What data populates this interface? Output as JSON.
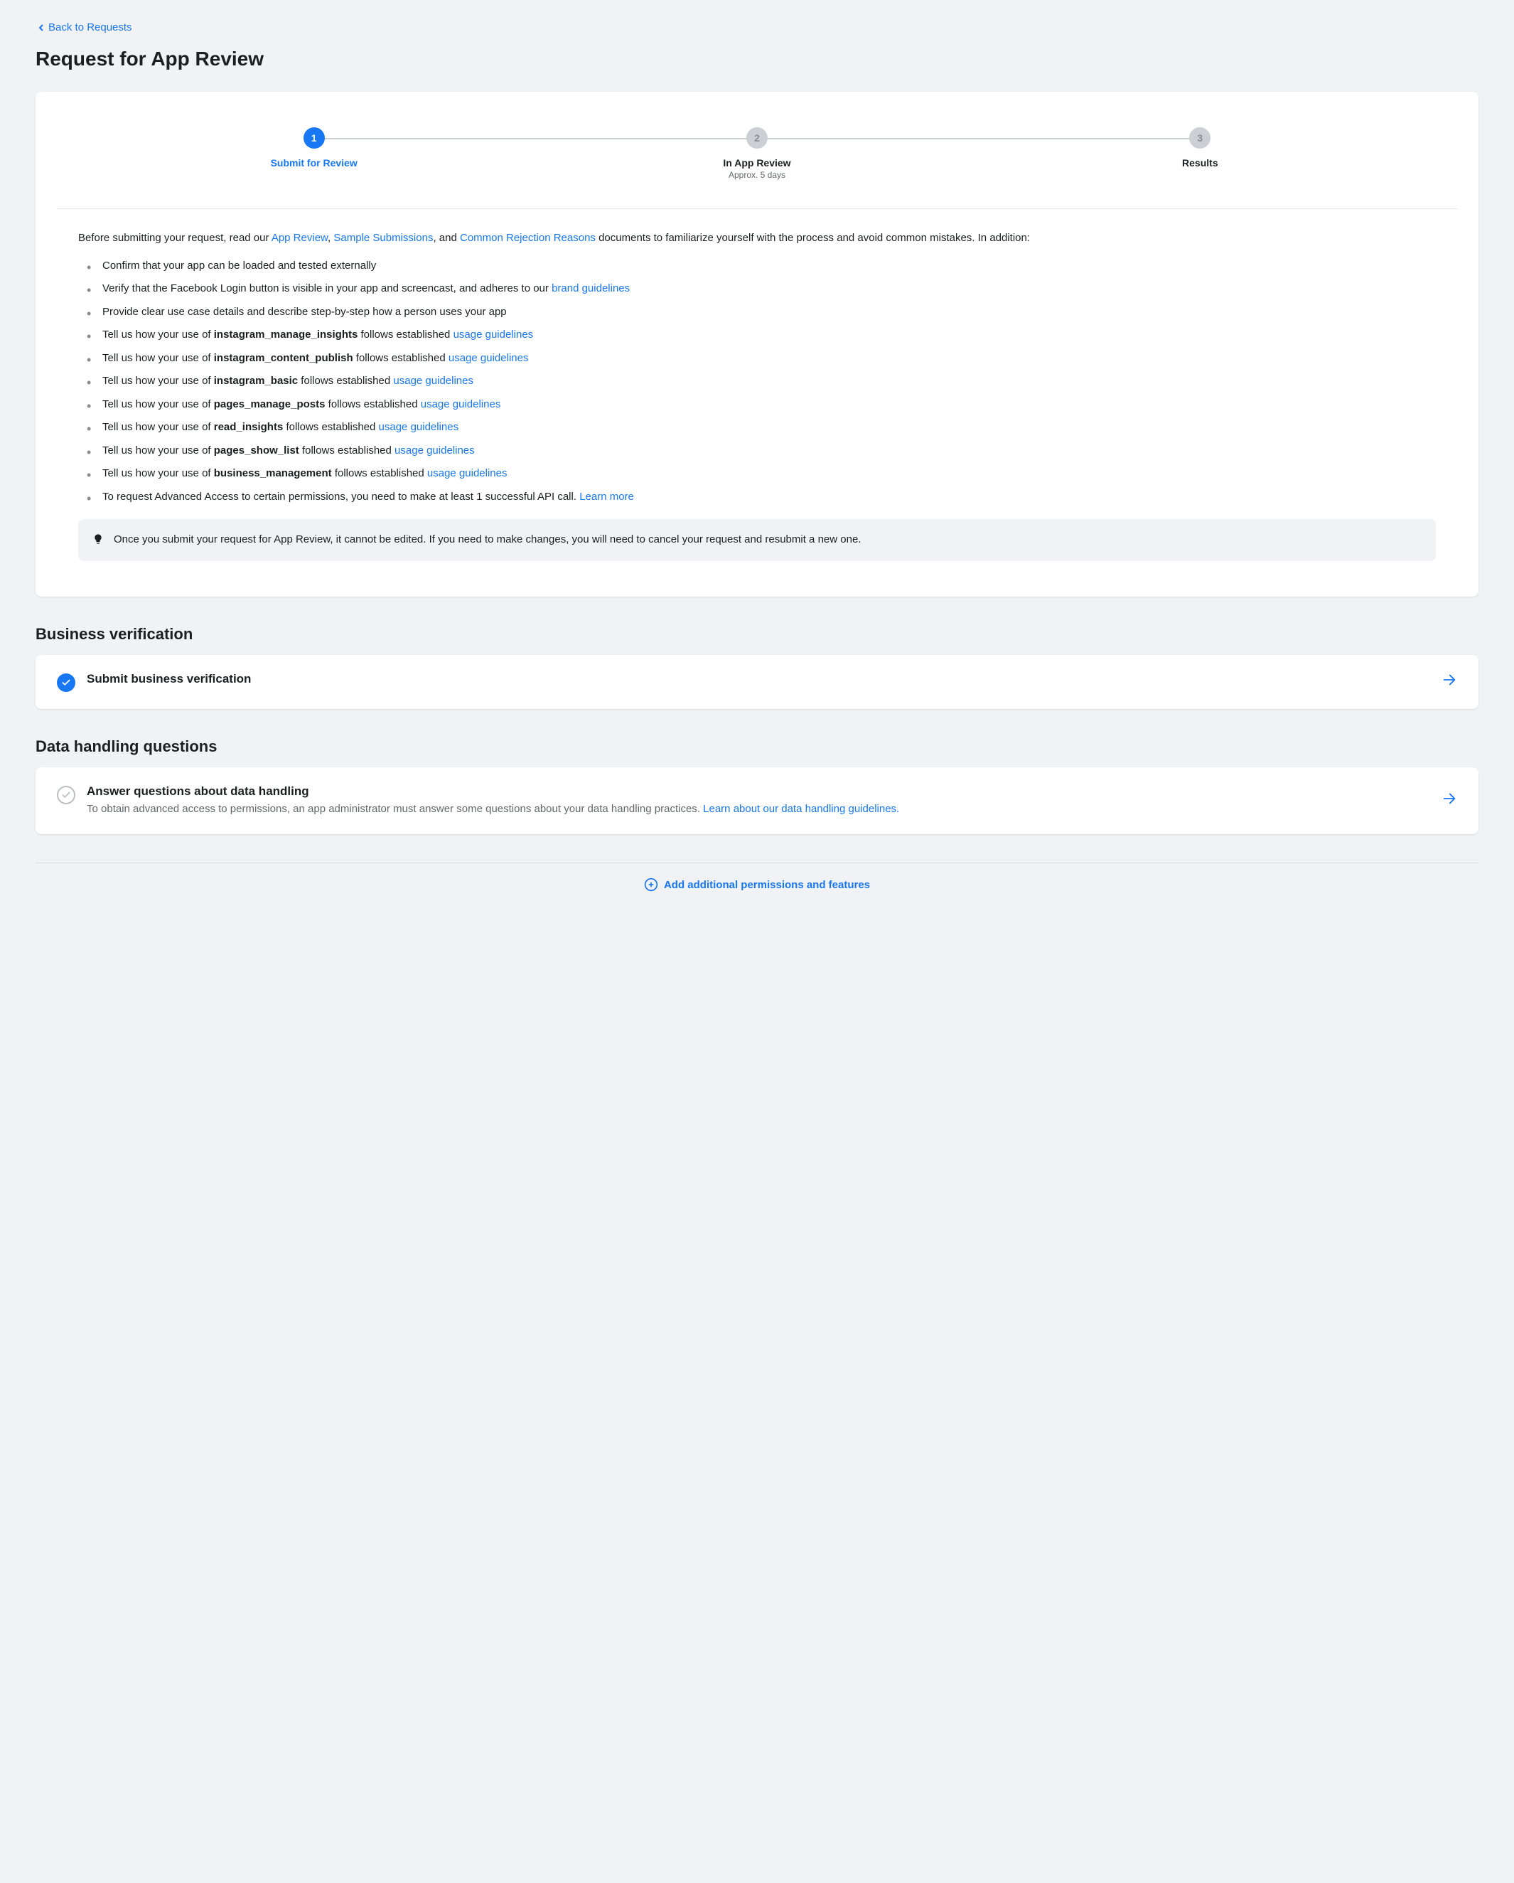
{
  "nav": {
    "back_label": "Back to Requests"
  },
  "page_title": "Request for App Review",
  "steps": [
    {
      "num": "1",
      "label": "Submit for Review",
      "active": true
    },
    {
      "num": "2",
      "label": "In App Review",
      "sublabel": "Approx. 5 days",
      "active": false
    },
    {
      "num": "3",
      "label": "Results",
      "active": false
    }
  ],
  "intro": {
    "prefix": "Before submitting your request, read our ",
    "link1": "App Review",
    "sep1": ", ",
    "link2": "Sample Submissions",
    "sep2": ", and ",
    "link3": "Common Rejection Reasons",
    "suffix": " documents to familiarize yourself with the process and avoid common mistakes. In addition:"
  },
  "checklist": [
    {
      "text": "Confirm that your app can be loaded and tested externally"
    },
    {
      "text_pre": "Verify that the Facebook Login button is visible in your app and screencast, and adheres to our ",
      "link": "brand guidelines"
    },
    {
      "text": "Provide clear use case details and describe step-by-step how a person uses your app"
    },
    {
      "pre": "Tell us how your use of ",
      "bold": "instagram_manage_insights",
      "mid": " follows established ",
      "link": "usage guidelines"
    },
    {
      "pre": "Tell us how your use of ",
      "bold": "instagram_content_publish",
      "mid": " follows established ",
      "link": "usage guidelines"
    },
    {
      "pre": "Tell us how your use of ",
      "bold": "instagram_basic",
      "mid": " follows established ",
      "link": "usage guidelines"
    },
    {
      "pre": "Tell us how your use of ",
      "bold": "pages_manage_posts",
      "mid": " follows established ",
      "link": "usage guidelines"
    },
    {
      "pre": "Tell us how your use of ",
      "bold": "read_insights",
      "mid": " follows established ",
      "link": "usage guidelines"
    },
    {
      "pre": "Tell us how your use of ",
      "bold": "pages_show_list",
      "mid": " follows established ",
      "link": "usage guidelines"
    },
    {
      "pre": "Tell us how your use of ",
      "bold": "business_management",
      "mid": " follows established ",
      "link": "usage guidelines"
    },
    {
      "text_pre": "To request Advanced Access to certain permissions, you need to make at least 1 successful API call. ",
      "link": "Learn more"
    }
  ],
  "tip": {
    "text": "Once you submit your request for App Review, it cannot be edited. If you need to make changes, you will need to cancel your request and resubmit a new one."
  },
  "sections": {
    "business": {
      "title": "Business verification",
      "action_title": "Submit business verification",
      "complete": true
    },
    "data": {
      "title": "Data handling questions",
      "action_title": "Answer questions about data handling",
      "desc_pre": "To obtain advanced access to permissions, an app administrator must answer some questions about your data handling practices. ",
      "desc_link": "Learn about our data handling guidelines.",
      "complete": false
    }
  },
  "footer": {
    "add_label": "Add additional permissions and features"
  }
}
